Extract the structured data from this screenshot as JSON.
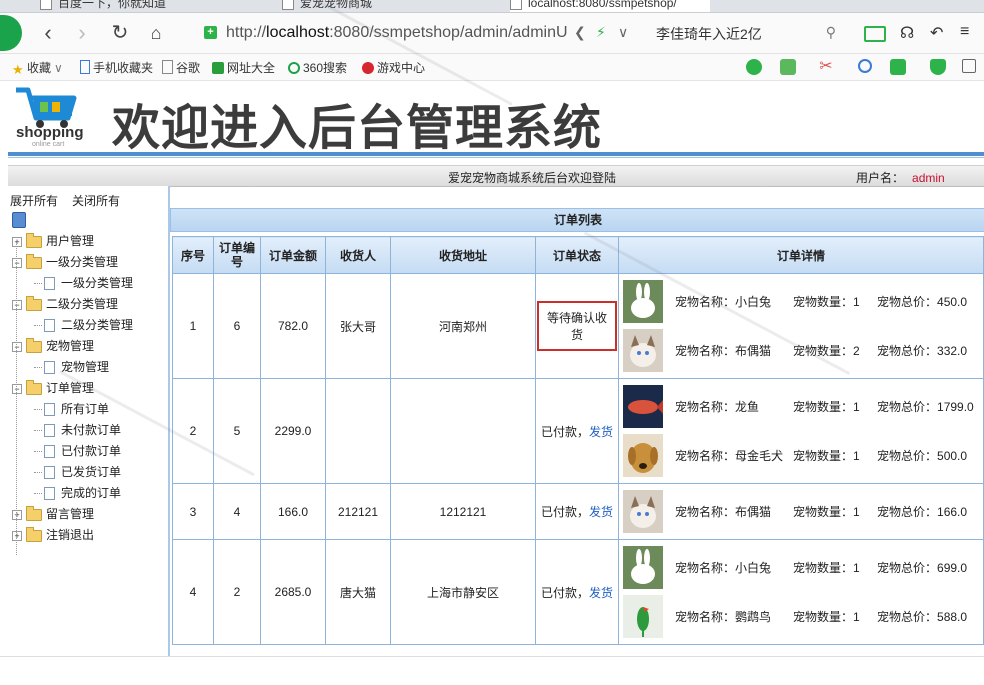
{
  "browser": {
    "tabs": [
      {
        "label": "百度一下，你就知道"
      },
      {
        "label": "爱宠宠物商城"
      },
      {
        "label": "localhost:8080/ssmpetshop/"
      }
    ],
    "url_prefix": "http://",
    "url_host": "localhost",
    "url_rest": ":8080/ssmpetshop/admin/adminU",
    "search_query": "李佳琦年入近2亿",
    "bookmarks": [
      {
        "label": "收藏",
        "color": "#e9b100"
      },
      {
        "label": "手机收藏夹",
        "color": "#3a7bd5"
      },
      {
        "label": "谷歌",
        "color": "#888888"
      },
      {
        "label": "网址大全",
        "color": "#2a9d3c"
      },
      {
        "label": "360搜索",
        "color": "#1aa34a"
      },
      {
        "label": "游戏中心",
        "color": "#d7262e"
      }
    ]
  },
  "header": {
    "logo_text": "shopping",
    "logo_sub": "online cart",
    "title": "欢迎进入后台管理系统",
    "welcome": "爱宠宠物商城系统后台欢迎登陆",
    "user_label": "用户名：",
    "user_name": "admin"
  },
  "sidebar": {
    "expand_all": "展开所有",
    "collapse_all": "关闭所有",
    "tree": [
      {
        "label": "用户管理",
        "level": 0,
        "toggle": "+"
      },
      {
        "label": "一级分类管理",
        "level": 0,
        "toggle": "-"
      },
      {
        "label": "一级分类管理",
        "level": 1
      },
      {
        "label": "二级分类管理",
        "level": 0,
        "toggle": "-"
      },
      {
        "label": "二级分类管理",
        "level": 1
      },
      {
        "label": "宠物管理",
        "level": 0,
        "toggle": "-"
      },
      {
        "label": "宠物管理",
        "level": 1
      },
      {
        "label": "订单管理",
        "level": 0,
        "toggle": "-"
      },
      {
        "label": "所有订单",
        "level": 1
      },
      {
        "label": "未付款订单",
        "level": 1
      },
      {
        "label": "已付款订单",
        "level": 1
      },
      {
        "label": "已发货订单",
        "level": 1
      },
      {
        "label": "完成的订单",
        "level": 1
      },
      {
        "label": "留言管理",
        "level": 0,
        "toggle": "+"
      },
      {
        "label": "注销退出",
        "level": 0,
        "toggle": "+"
      }
    ]
  },
  "orders": {
    "title": "订单列表",
    "columns": [
      "序号",
      "订单编号",
      "订单金额",
      "收货人",
      "收货地址",
      "订单状态",
      "订单详情"
    ],
    "name_label": "宠物名称：",
    "qty_label": "宠物数量：",
    "total_label": "宠物总价：",
    "ship_label": "发货",
    "rows": [
      {
        "index": "1",
        "order_no": "6",
        "amount": "782.0",
        "receiver": "张大哥",
        "address": "河南郑州",
        "status": "等待确认收货",
        "ship": false,
        "items": [
          {
            "name": "小白兔",
            "qty": "1",
            "total": "450.0",
            "thumb": "rabbit"
          },
          {
            "name": "布偶猫",
            "qty": "2",
            "total": "332.0",
            "thumb": "cat"
          }
        ]
      },
      {
        "index": "2",
        "order_no": "5",
        "amount": "2299.0",
        "receiver": "",
        "address": "",
        "status": "已付款，",
        "ship": true,
        "items": [
          {
            "name": "龙鱼",
            "qty": "1",
            "total": "1799.0",
            "thumb": "fish"
          },
          {
            "name": "母金毛犬",
            "qty": "1",
            "total": "500.0",
            "thumb": "dog"
          }
        ]
      },
      {
        "index": "3",
        "order_no": "4",
        "amount": "166.0",
        "receiver": "212121",
        "address": "1212121",
        "status": "已付款，",
        "ship": true,
        "items": [
          {
            "name": "布偶猫",
            "qty": "1",
            "total": "166.0",
            "thumb": "cat"
          }
        ]
      },
      {
        "index": "4",
        "order_no": "2",
        "amount": "2685.0",
        "receiver": "唐大猫",
        "address": "上海市静安区",
        "status": "已付款，",
        "ship": true,
        "items": [
          {
            "name": "小白兔",
            "qty": "1",
            "total": "699.0",
            "thumb": "rabbit"
          },
          {
            "name": "鹦鹉鸟",
            "qty": "1",
            "total": "588.0",
            "thumb": "parrot"
          }
        ]
      }
    ]
  },
  "colors": {
    "accent": "#4f8fd0",
    "admin_red": "#c8102e",
    "ship_link": "#1e5fc0",
    "highlight_box": "#c9302c"
  }
}
